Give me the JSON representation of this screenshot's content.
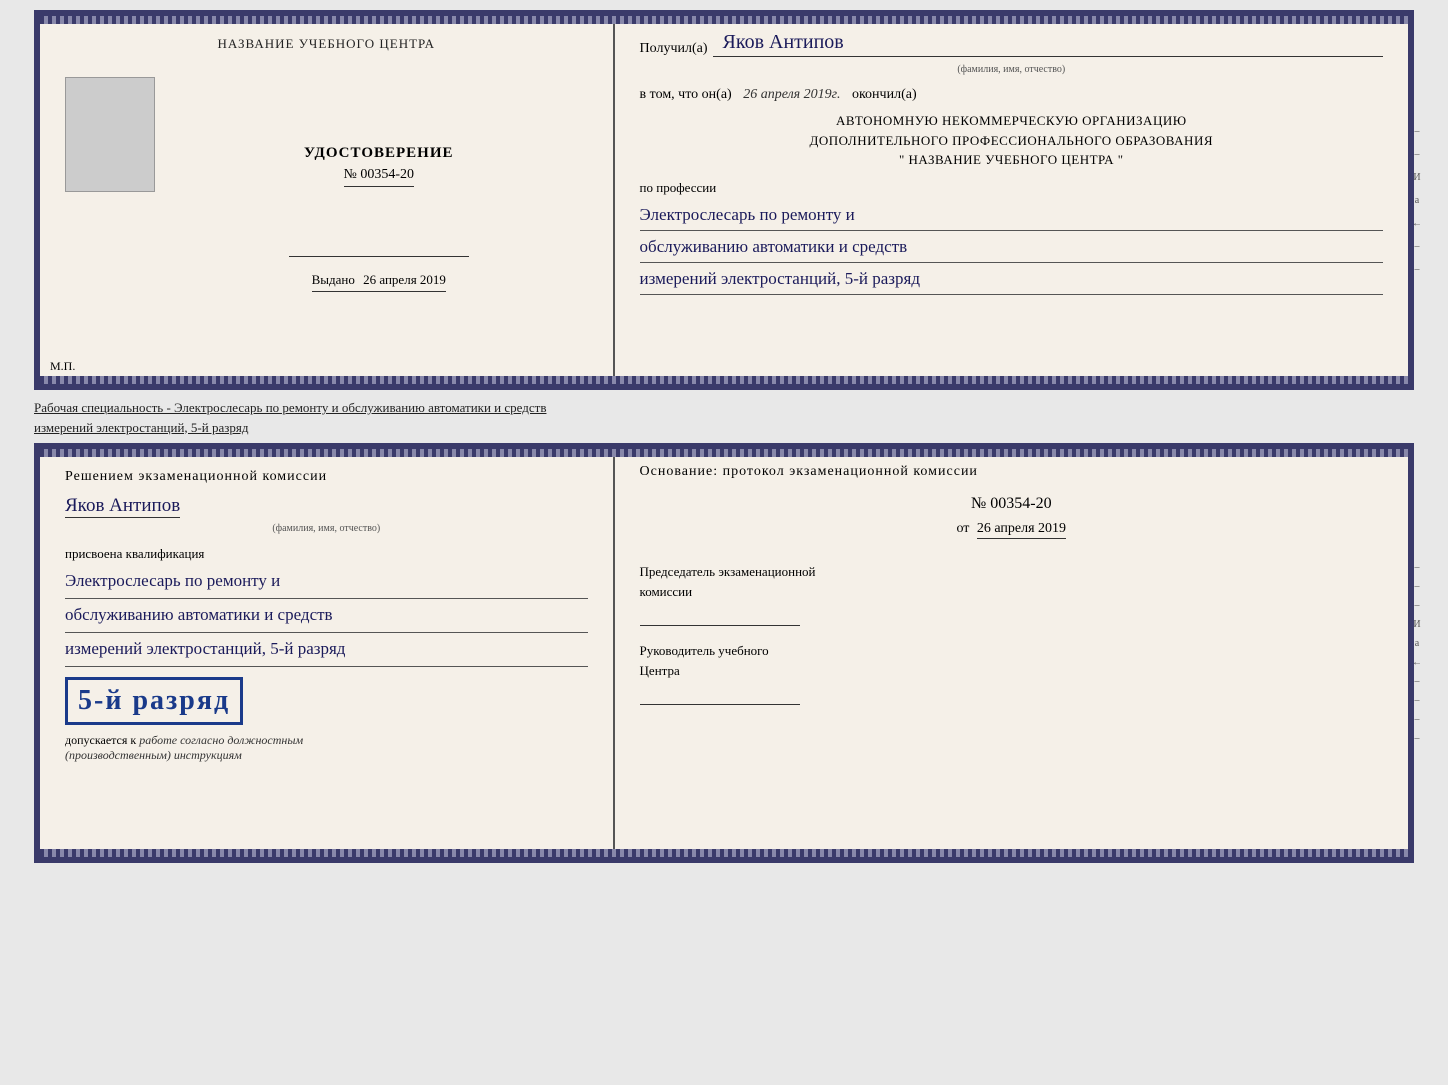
{
  "top_diploma": {
    "left": {
      "school_name": "НАЗВАНИЕ УЧЕБНОГО ЦЕНТРА",
      "udostoverenie_title": "УДОСТОВЕРЕНИЕ",
      "number": "№ 00354-20",
      "vydano_label": "Выдано",
      "vydano_date": "26 апреля 2019",
      "mp_label": "М.П."
    },
    "right": {
      "poluchil_label": "Получил(a)",
      "recipient_name": "Яков Антипов",
      "fio_label": "(фамилия, имя, отчество)",
      "v_tom_chto_prefix": "в том, что он(а)",
      "completion_date": "26 апреля 2019г.",
      "okonchil_label": "окончил(а)",
      "org_line1": "АВТОНОМНУЮ НЕКОММЕРЧЕСКУЮ ОРГАНИЗАЦИЮ",
      "org_line2": "ДОПОЛНИТЕЛЬНОГО ПРОФЕССИОНАЛЬНОГО ОБРАЗОВАНИЯ",
      "org_line3": "\"   НАЗВАНИЕ УЧЕБНОГО ЦЕНТРА   \"",
      "po_professii_label": "по профессии",
      "profession_line1": "Электрослесарь по ремонту и",
      "profession_line2": "обслуживанию автоматики и средств",
      "profession_line3": "измерений электростанций, 5-й разряд"
    }
  },
  "description": {
    "line1": "Рабочая специальность - Электрослесарь по ремонту и обслуживанию автоматики и средств",
    "line2": "измерений электростанций, 5-й разряд"
  },
  "bottom_diploma": {
    "left": {
      "resheniem_label": "Решением экзаменационной комиссии",
      "komissia_name": "Яков Антипов",
      "fio_label": "(фамилия, имя, отчество)",
      "prisvoena_label": "присвоена квалификация",
      "profession_line1": "Электрослесарь по ремонту и",
      "profession_line2": "обслуживанию автоматики и средств",
      "profession_line3": "измерений электростанций, 5-й разряд",
      "razryad_badge": "5-й разряд",
      "dopuskaetsya_label": "допускается к",
      "dopuskaetsya_text": "работе согласно должностным",
      "dopuskaetsya_text2": "(производственным) инструкциям"
    },
    "right": {
      "osnovanie_label": "Основание: протокол экзаменационной комиссии",
      "protocol_number": "№  00354-20",
      "ot_label": "от",
      "protocol_date": "26 апреля 2019",
      "predsedatel_label": "Председатель экзаменационной",
      "komissia_label": "комиссии",
      "rukovoditel_label": "Руководитель учебного",
      "centra_label": "Центра"
    }
  },
  "side_labels": {
    "items": [
      "И",
      "а",
      "←",
      "–",
      "–",
      "–"
    ]
  }
}
